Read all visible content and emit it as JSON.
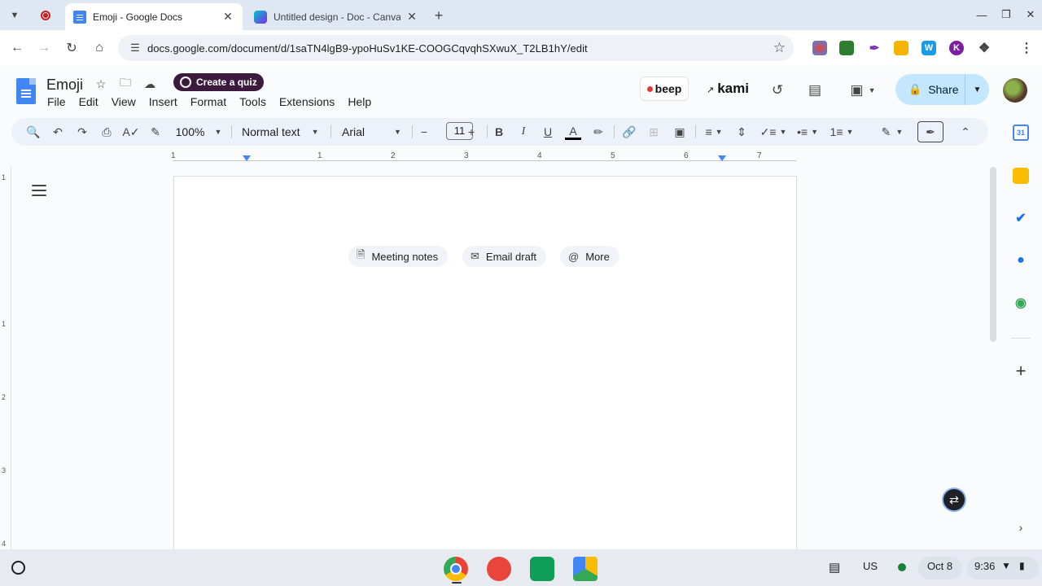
{
  "browser": {
    "tabs": [
      {
        "title": "Emoji - Google Docs",
        "active": true,
        "favicon": "docs-icon"
      },
      {
        "title": "Untitled design - Doc - Canva",
        "active": false,
        "favicon": "canva-icon"
      }
    ],
    "url": "docs.google.com/document/d/1saTN4lgB9-ypoHuSv1KE-COOGCqvqhSXwuX_T2LB1hY/edit",
    "extensions": [
      "puzzle-colorful-icon",
      "green-square-icon",
      "pen-icon",
      "gold-icon",
      "w-icon",
      "k-icon",
      "extensions-puzzle-icon"
    ]
  },
  "docs": {
    "title": "Emoji",
    "quiz_button": "Create a quiz",
    "menu": [
      "File",
      "Edit",
      "View",
      "Insert",
      "Format",
      "Tools",
      "Extensions",
      "Help"
    ],
    "beep_label": "beep",
    "kami_label": "kami",
    "share_label": "Share"
  },
  "toolbar": {
    "zoom": "100%",
    "style": "Normal text",
    "font": "Arial",
    "font_size": "11"
  },
  "ruler": {
    "labels": [
      "1",
      "1",
      "2",
      "3",
      "4",
      "5",
      "6",
      "7"
    ],
    "vlabels": [
      "1",
      "1",
      "2",
      "3",
      "4"
    ]
  },
  "document": {
    "chips": [
      {
        "label": "Meeting notes",
        "icon": "document-icon"
      },
      {
        "label": "Email draft",
        "icon": "email-icon"
      },
      {
        "label": "More",
        "icon": "at-icon"
      }
    ]
  },
  "shelf": {
    "apps": [
      "chrome-icon",
      "canvas-paint-icon",
      "classroom-icon",
      "drive-icon"
    ],
    "ime": "US",
    "date": "Oct 8",
    "time": "9:36"
  },
  "colors": {
    "share_bg": "#c2e7ff",
    "quiz_bg": "#3c1a3d",
    "toolbar_bg": "#edf2fa",
    "docs_blue": "#4285f4"
  }
}
